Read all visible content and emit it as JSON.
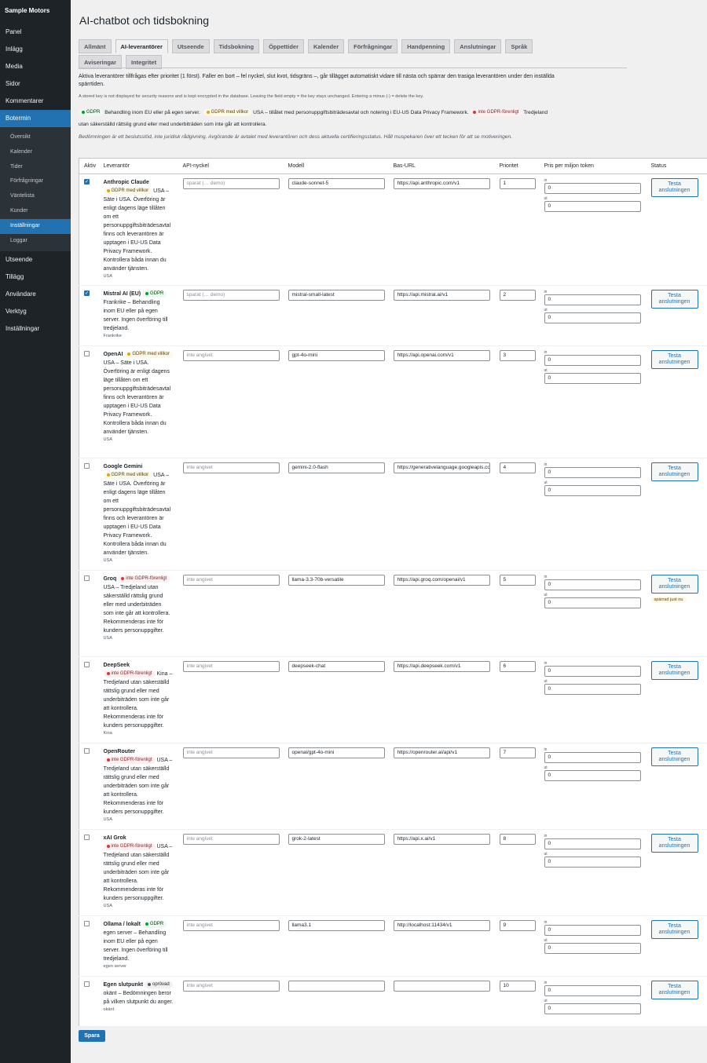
{
  "sidebar": {
    "brand": "Sample Motors",
    "items": [
      {
        "label": "Panel",
        "active": false
      },
      {
        "label": "Inlägg",
        "active": false
      },
      {
        "label": "Media",
        "active": false
      },
      {
        "label": "Sidor",
        "active": false
      },
      {
        "label": "Kommentarer",
        "active": false
      },
      {
        "label": "Botermin",
        "active": true
      }
    ],
    "subitems": [
      {
        "label": "Översikt",
        "active": false
      },
      {
        "label": "Kalender",
        "active": false
      },
      {
        "label": "Tider",
        "active": false
      },
      {
        "label": "Förfrågningar",
        "active": false
      },
      {
        "label": "Väntelista",
        "active": false
      },
      {
        "label": "Kunder",
        "active": false
      },
      {
        "label": "Inställningar",
        "active": true
      },
      {
        "label": "Loggar",
        "active": false
      }
    ],
    "items_after": [
      {
        "label": "Utseende"
      },
      {
        "label": "Tillägg"
      },
      {
        "label": "Användare"
      },
      {
        "label": "Verktyg"
      },
      {
        "label": "Inställningar"
      }
    ]
  },
  "page": {
    "title": "AI-chatbot och tidsbokning",
    "tabs": [
      {
        "label": "Allmänt",
        "active": false
      },
      {
        "label": "AI-leverantörer",
        "active": true
      },
      {
        "label": "Utseende",
        "active": false
      },
      {
        "label": "Tidsbokning",
        "active": false
      },
      {
        "label": "Öppettider",
        "active": false
      },
      {
        "label": "Kalender",
        "active": false
      },
      {
        "label": "Förfrågningar",
        "active": false
      },
      {
        "label": "Handpenning",
        "active": false
      },
      {
        "label": "Anslutningar",
        "active": false
      },
      {
        "label": "Språk",
        "active": false
      },
      {
        "label": "Aviseringar",
        "active": false
      },
      {
        "label": "Integritet",
        "active": false
      }
    ],
    "intro": "Aktiva leverantörer tillfrågas efter prioritet (1 först). Faller en bort – fel nyckel, slut kvot, tidsgräns –, går tillägget automatiskt vidare till nästa och spärrar den trasiga leverantören under den inställda spärrtiden.",
    "key_note": "A stored key is not displayed for security reasons and is kept encrypted in the database. Leaving the field empty = the key stays unchanged. Entering a minus (-) = delete the key.",
    "legend": {
      "gdpr": "GDPR",
      "gdpr_text": "Behandling inom EU eller på egen server.",
      "conditional": "GDPR med villkor",
      "conditional_text": "USA – tillåtet med personuppgiftsbiträdesavtal och notering i EU-US Data Privacy Framework.",
      "not_compliant": "inte GDPR-förenligt",
      "not_compliant_text": "Tredjeland utan säkerställd rättslig grund eller med underbiträden som inte går att kontrollera."
    },
    "disclaimer": "Bedömningen är ett beslutsstöd, inte juridisk rådgivning. Avgörande är avtalet med leverantören och dess aktuella certifieringsstatus. Håll muspekaren över ett tecken för att se motiveringen.",
    "save_label": "Spara"
  },
  "table": {
    "headers": {
      "active": "Aktiv",
      "provider": "Leverantör",
      "api_key": "API-nyckel",
      "model": "Modell",
      "base_url": "Bas-URL",
      "priority": "Prioritet",
      "price": "Pris per miljon token",
      "status": "Status"
    },
    "price_in_label": "in",
    "price_out_label": "ut",
    "test_label": "Testa anslutningen",
    "rows": [
      {
        "name": "Anthropic Claude",
        "active": true,
        "badge_type": "conditional",
        "badge": "GDPR med villkor",
        "desc": "USA – Säte i USA. Överföring är enligt dagens läge tillåten om ett personuppgiftsbiträdesavtal finns och leverantören är upptagen i EU-US Data Privacy Framework. Kontrollera båda innan du använder tjänsten.",
        "country": "USA",
        "api_key": "sparat (… demo)",
        "api_key_placeholder": false,
        "model": "claude-sonnet-5",
        "base_url": "https://api.anthropic.com/v1",
        "priority": "1",
        "price_in": "0",
        "price_out": "0",
        "status": "",
        "height": 142
      },
      {
        "name": "Mistral AI (EU)",
        "active": true,
        "badge_type": "gdpr",
        "badge": "GDPR",
        "desc": "Frankrike – Behandling inom EU eller på egen server. Ingen överföring till tredjeland.",
        "country": "Frankrike",
        "api_key": "sparat (… demo)",
        "api_key_placeholder": false,
        "model": "mistral-small-latest",
        "base_url": "https://api.mistral.ai/v1",
        "priority": "2",
        "price_in": "0",
        "price_out": "0",
        "status": "",
        "height": 77
      },
      {
        "name": "OpenAI",
        "active": false,
        "badge_type": "conditional",
        "badge": "GDPR med villkor",
        "desc": "USA – Säte i USA. Överföring är enligt dagens läge tillåten om ett personuppgiftsbiträdesavtal finns och leverantören är upptagen i EU-US Data Privacy Framework. Kontrollera båda innan du använder tjänsten.",
        "country": "USA",
        "api_key": "inte angivet",
        "api_key_placeholder": true,
        "model": "gpt-4o-mini",
        "base_url": "https://api.openai.com/v1",
        "priority": "3",
        "price_in": "0",
        "price_out": "0",
        "status": "",
        "height": 143
      },
      {
        "name": "Google Gemini",
        "active": false,
        "badge_type": "conditional",
        "badge": "GDPR med villkor",
        "desc": "USA – Säte i USA. Överföring är enligt dagens läge tillåten om ett personuppgiftsbiträdesavtal finns och leverantören är upptagen i EU-US Data Privacy Framework. Kontrollera båda innan du använder tjänsten.",
        "country": "USA",
        "api_key": "inte angivet",
        "api_key_placeholder": true,
        "model": "gemini-2.0-flash",
        "base_url": "https://generativelanguage.googleapis.com/v1beta",
        "priority": "4",
        "price_in": "0",
        "price_out": "0",
        "status": "",
        "height": 143
      },
      {
        "name": "Groq",
        "active": false,
        "badge_type": "not_compliant",
        "badge": "inte GDPR-förenligt",
        "desc": "USA – Tredjeland utan säkerställd rättslig grund eller med underbiträden som inte går att kontrollera. Rekommenderas inte för kunders personuppgifter.",
        "country": "USA",
        "api_key": "inte angivet",
        "api_key_placeholder": true,
        "model": "llama-3.3-70b-versatile",
        "base_url": "https://api.groq.com/openai/v1",
        "priority": "5",
        "price_in": "0",
        "price_out": "0",
        "status": "spärrad just nu",
        "height": 110
      },
      {
        "name": "DeepSeek",
        "active": false,
        "badge_type": "not_compliant",
        "badge": "inte GDPR-förenligt",
        "desc": "Kina – Tredjeland utan säkerställd rättslig grund eller med underbiträden som inte går att kontrollera. Rekommenderas inte för kunders personuppgifter.",
        "country": "Kina",
        "api_key": "inte angivet",
        "api_key_placeholder": true,
        "model": "deepseek-chat",
        "base_url": "https://api.deepseek.com/v1",
        "priority": "6",
        "price_in": "0",
        "price_out": "0",
        "status": "",
        "height": 110
      },
      {
        "name": "OpenRouter",
        "active": false,
        "badge_type": "not_compliant",
        "badge": "inte GDPR-förenligt",
        "desc": "USA – Tredjeland utan säkerställd rättslig grund eller med underbiträden som inte går att kontrollera. Rekommenderas inte för kunders personuppgifter.",
        "country": "USA",
        "api_key": "inte angivet",
        "api_key_placeholder": true,
        "model": "openai/gpt-4o-mini",
        "base_url": "https://openrouter.ai/api/v1",
        "priority": "7",
        "price_in": "0",
        "price_out": "0",
        "status": "",
        "height": 110
      },
      {
        "name": "xAI Grok",
        "active": false,
        "badge_type": "not_compliant",
        "badge": "inte GDPR-förenligt",
        "desc": "USA – Tredjeland utan säkerställd rättslig grund eller med underbiträden som inte går att kontrollera. Rekommenderas inte för kunders personuppgifter.",
        "country": "USA",
        "api_key": "inte angivet",
        "api_key_placeholder": true,
        "model": "grok-2-latest",
        "base_url": "https://api.x.ai/v1",
        "priority": "8",
        "price_in": "0",
        "price_out": "0",
        "status": "",
        "height": 110
      },
      {
        "name": "Ollama / lokalt",
        "active": false,
        "badge_type": "gdpr",
        "badge": "GDPR",
        "desc": "egen server – Behandling inom EU eller på egen server. Ingen överföring till tredjeland.",
        "country": "egen server",
        "api_key": "inte angivet",
        "api_key_placeholder": true,
        "model": "llama3.1",
        "base_url": "http://localhost:11434/v1",
        "priority": "9",
        "price_in": "0",
        "price_out": "0",
        "status": "",
        "height": 77
      },
      {
        "name": "Egen slutpunkt",
        "active": false,
        "badge_type": "unreviewed",
        "badge": "oprövad",
        "desc": "okänt – Bedömningen beror på vilken slutpunkt du anger.",
        "country": "okänt",
        "api_key": "inte angivet",
        "api_key_placeholder": true,
        "model": "",
        "base_url": "",
        "priority": "10",
        "price_in": "0",
        "price_out": "0",
        "status": "",
        "height": 64
      }
    ]
  }
}
